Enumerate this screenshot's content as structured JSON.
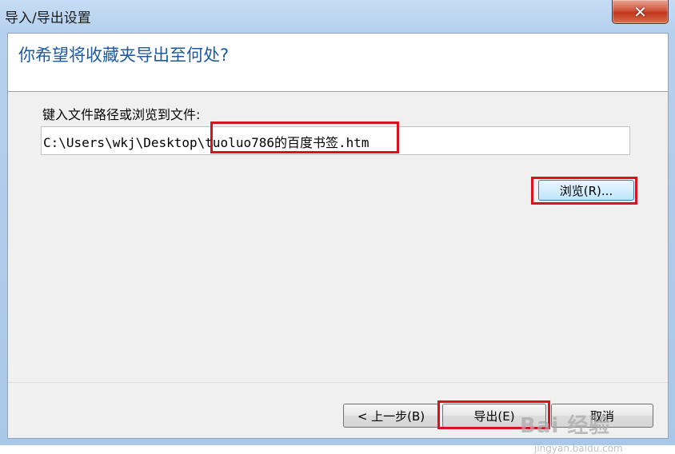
{
  "window": {
    "title": "导入/导出设置",
    "close_symbol": "✕"
  },
  "header": {
    "title": "你希望将收藏夹导出至何处?"
  },
  "form": {
    "prompt": "键入文件路径或浏览到文件:",
    "path_value": "C:\\Users\\wkj\\Desktop\\tuoluo786的百度书签.htm",
    "browse_label": "浏览(R)..."
  },
  "footer": {
    "back_label": "< 上一步(B)",
    "export_label": "导出(E)",
    "cancel_label": "取消"
  },
  "watermark": {
    "logo": "Bai 经验",
    "url": "jingyan.baidu.com"
  },
  "colors": {
    "highlight": "#d8131b",
    "title_blue": "#1e5aa0"
  }
}
